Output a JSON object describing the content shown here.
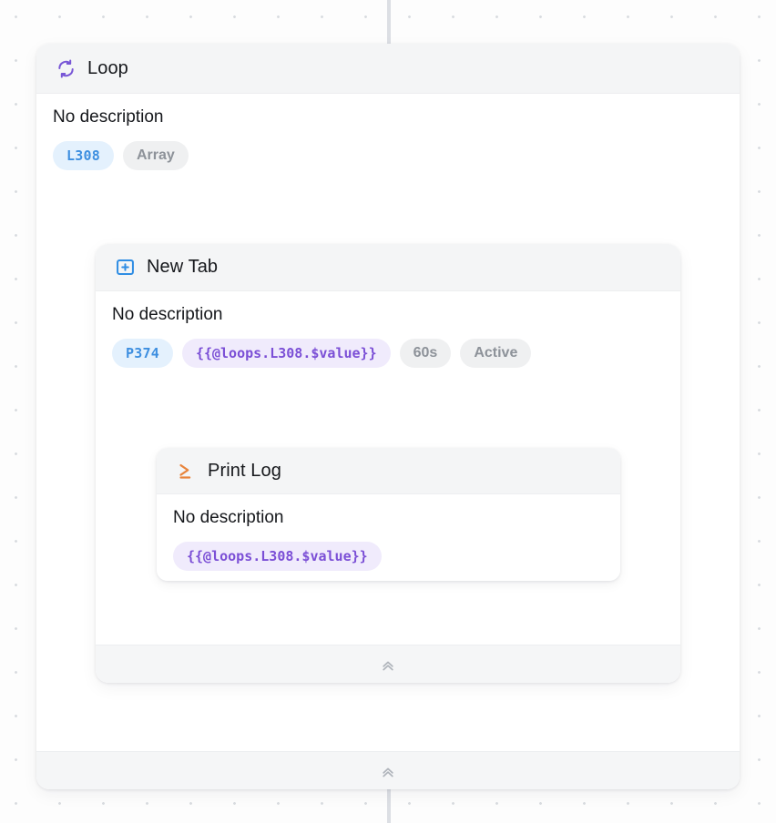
{
  "canvas": {
    "background_color": "#fdfdfd",
    "dot_color": "#d9dce0",
    "connector_color": "#dcdfe4"
  },
  "nodes": {
    "loop": {
      "title": "Loop",
      "icon": "loop-refresh-icon",
      "icon_color": "#7856d6",
      "description": "No description",
      "badges": [
        {
          "label": "L308",
          "style": "id",
          "color": "#3e8fe0",
          "background": "#e4f1fd"
        },
        {
          "label": "Array",
          "style": "muted",
          "color": "#8d9299",
          "background": "#eff0f1"
        }
      ],
      "collapse_label": "chevron-double-up-icon"
    },
    "new_tab": {
      "title": "New Tab",
      "icon": "new-tab-plus-icon",
      "icon_color": "#2f8de4",
      "description": "No description",
      "badges": [
        {
          "label": "P374",
          "style": "id",
          "color": "#3e8fe0",
          "background": "#e4f1fd"
        },
        {
          "label": "{{@loops.L308.$value}}",
          "style": "template",
          "color": "#7b4fd6",
          "background": "#f0ebfc"
        },
        {
          "label": "60s",
          "style": "muted",
          "color": "#8d9299",
          "background": "#eff0f1"
        },
        {
          "label": "Active",
          "style": "muted",
          "color": "#8d9299",
          "background": "#eff0f1"
        }
      ],
      "collapse_label": "chevron-double-up-icon"
    },
    "print_log": {
      "title": "Print Log",
      "icon": "terminal-prompt-icon",
      "icon_color": "#e8843c",
      "description": "No description",
      "badges": [
        {
          "label": "{{@loops.L308.$value}}",
          "style": "template",
          "color": "#7b4fd6",
          "background": "#f0ebfc"
        }
      ]
    }
  }
}
